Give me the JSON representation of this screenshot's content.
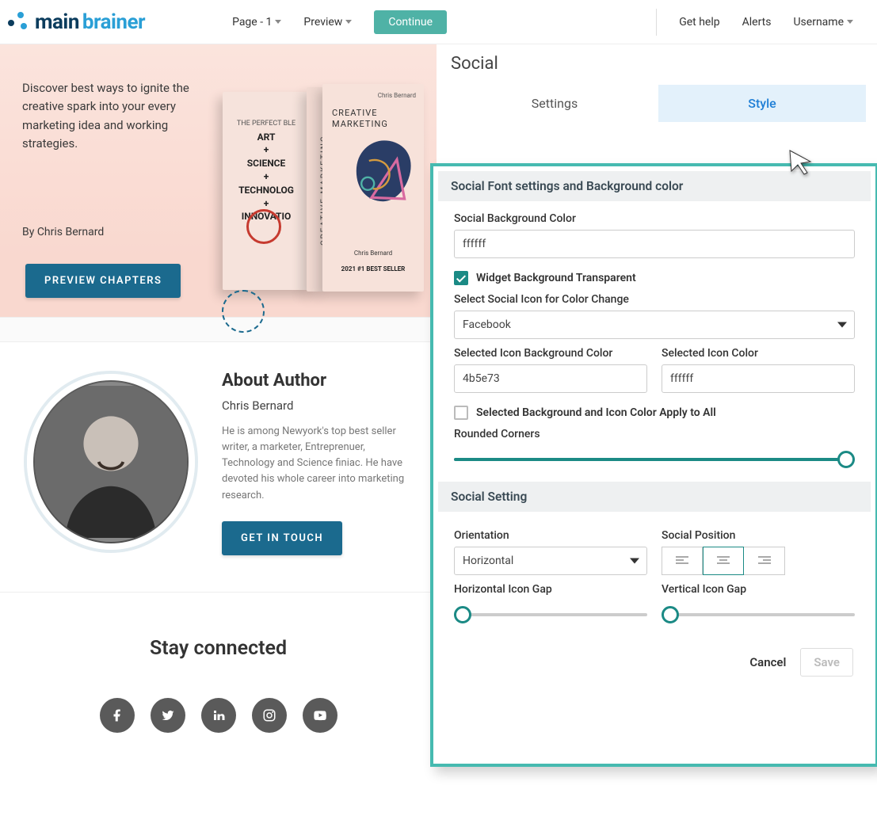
{
  "topbar": {
    "logo_part1": "main",
    "logo_part2": "brainer",
    "page_dropdown": "Page - 1",
    "preview_dropdown": "Preview",
    "continue": "Continue",
    "get_help": "Get help",
    "alerts": "Alerts",
    "username": "Username"
  },
  "hero": {
    "text": "Discover best ways to ignite the creative spark into your every marketing idea and working strategies.",
    "author_line": "By Chris Bernard",
    "cta": "PREVIEW CHAPTERS",
    "book_back_top": "THE PERFECT BLE",
    "book_back_lines": "ART\n+\nSCIENCE\n+\nTECHNOLOG\n+\nINNOVATIO",
    "spine": "CREATIVE MARKETING",
    "book_front_author": "Chris Bernard",
    "book_front_title": "CREATIVE\nMARKETING",
    "book_front_name": "Chris Bernard",
    "book_front_seller": "2021 #1 BEST SELLER"
  },
  "author": {
    "heading": "About Author",
    "name": "Chris Bernard",
    "bio": "He is among Newyork's top best seller writer, a marketer, Entreprenuer, Technology and Science finiac. He have devoted his whole career into marketing research.",
    "cta": "GET IN TOUCH"
  },
  "footer": {
    "heading": "Stay connected",
    "icons": [
      "facebook-icon",
      "twitter-icon",
      "linkedin-icon",
      "instagram-icon",
      "youtube-icon"
    ]
  },
  "panel": {
    "title": "Social",
    "tabs": {
      "settings": "Settings",
      "style": "Style"
    },
    "section1_header": "Social Font settings and Background color",
    "bg_label": "Social Background Color",
    "bg_value": "ffffff",
    "transparent_label": "Widget Background Transparent",
    "transparent_checked": true,
    "icon_select_label": "Select Social Icon for Color Change",
    "icon_select_value": "Facebook",
    "icon_bg_label": "Selected Icon Background Color",
    "icon_bg_value": "4b5e73",
    "icon_color_label": "Selected Icon Color",
    "icon_color_value": "ffffff",
    "apply_all_label": "Selected Background and Icon Color Apply to All",
    "apply_all_checked": false,
    "rounded_label": "Rounded Corners",
    "rounded_pct": 100,
    "section2_header": "Social Setting",
    "orientation_label": "Orientation",
    "orientation_value": "Horizontal",
    "position_label": "Social Position",
    "position_value": "center",
    "hgap_label": "Horizontal Icon Gap",
    "hgap_pct": 0,
    "vgap_label": "Vertical Icon Gap",
    "vgap_pct": 0,
    "cancel": "Cancel",
    "save": "Save"
  }
}
